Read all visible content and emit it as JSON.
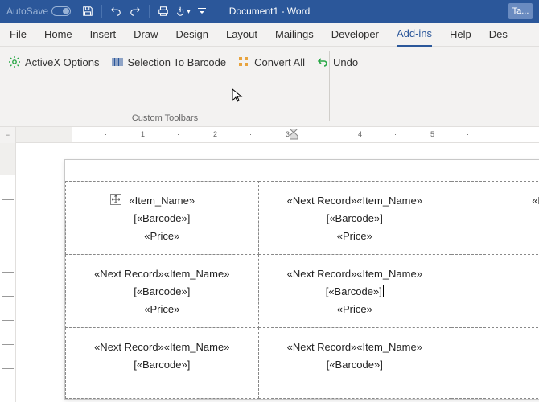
{
  "titlebar": {
    "autosave": "AutoSave",
    "doc_title": "Document1  -  Word",
    "account": "Ta..."
  },
  "tabs": {
    "file": "File",
    "home": "Home",
    "insert": "Insert",
    "draw": "Draw",
    "design": "Design",
    "layout": "Layout",
    "mailings": "Mailings",
    "developer": "Developer",
    "addins": "Add-ins",
    "help": "Help",
    "design2": "Des"
  },
  "ribbon": {
    "activex": "ActiveX Options",
    "selection_to_barcode": "Selection To Barcode",
    "convert_all": "Convert All",
    "undo": "Undo",
    "group_label": "Custom Toolbars"
  },
  "ruler": {
    "n1": "1",
    "n2": "2",
    "n3": "3",
    "n4": "4",
    "n5": "5"
  },
  "fields": {
    "item_name": "«Item_Name»",
    "next_record_item_name": "«Next Record»«Item_Name»",
    "barcode": "[«Barcode»]",
    "price": "«Price»",
    "partial_next": "«N"
  }
}
